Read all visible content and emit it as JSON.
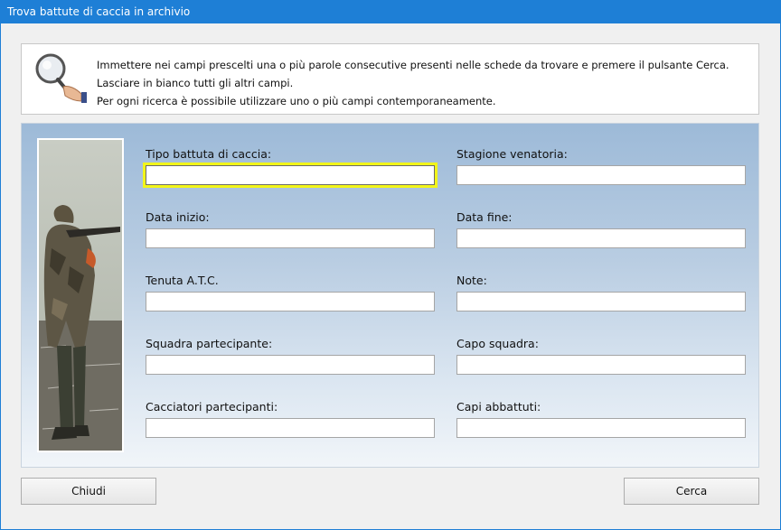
{
  "window": {
    "title": "Trova battute di caccia in archivio"
  },
  "info": {
    "line1": "Immettere nei campi prescelti una o più parole consecutive presenti nelle schede da trovare e premere il pulsante Cerca.",
    "line2": "Lasciare in bianco tutti gli altri campi.",
    "line3": "Per ogni ricerca è possibile utilizzare uno o più campi contemporaneamente."
  },
  "fields": [
    {
      "label": "Tipo battuta di caccia:",
      "value": ""
    },
    {
      "label": "Stagione venatoria:",
      "value": ""
    },
    {
      "label": "Data inizio:",
      "value": ""
    },
    {
      "label": "Data fine:",
      "value": ""
    },
    {
      "label": "Tenuta A.T.C.",
      "value": ""
    },
    {
      "label": "Note:",
      "value": ""
    },
    {
      "label": "Squadra partecipante:",
      "value": ""
    },
    {
      "label": "Capo squadra:",
      "value": ""
    },
    {
      "label": "Cacciatori partecipanti:",
      "value": ""
    },
    {
      "label": "Capi abbattuti:",
      "value": ""
    }
  ],
  "buttons": {
    "close": "Chiudi",
    "search": "Cerca"
  },
  "colors": {
    "titlebar": "#1e7fd6",
    "focus_ring": "#f2f51a"
  }
}
